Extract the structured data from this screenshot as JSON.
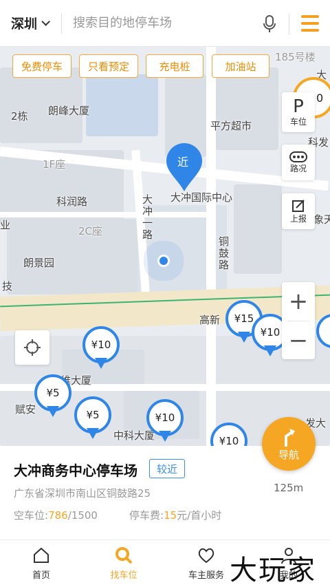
{
  "topbar": {
    "city": "深圳",
    "search_placeholder": "搜索目的地停车场"
  },
  "filters": [
    "免费停车",
    "只看预定",
    "充电桩",
    "加油站"
  ],
  "map_labels": {
    "langfeng": "朗峰大厦",
    "two_dong": "2栋",
    "one_f": "1F座",
    "kerun_road": "科润路",
    "two_c": "2C座",
    "langjing": "朗景园",
    "ye": "业",
    "dachong_road": "大冲一路",
    "tonggu_road": "铜鼓路",
    "pingfang": "平方超市",
    "center": "大冲国际中心",
    "gaoxin": "高新",
    "zhongke": "中科大厦",
    "fuan": "赋安",
    "wei": "维大厦",
    "fa": "发大",
    "ke": "科发",
    "xiangtian": "象天",
    "building185": "185号楼",
    "da": "大",
    "ji": "技",
    "lu": "路"
  },
  "near_pin": "近",
  "tools": {
    "parking_letter": "P",
    "parking_label": "车位",
    "traffic_label": "路况",
    "report_label": "上报"
  },
  "zoom": {
    "in": "+",
    "out": "−"
  },
  "pins": [
    {
      "label": "¥15"
    },
    {
      "label": "¥10"
    },
    {
      "label": "¥10"
    },
    {
      "label": "¥5"
    },
    {
      "label": "¥5"
    },
    {
      "label": "¥10"
    },
    {
      "label": "¥10"
    }
  ],
  "corner_badge": "0",
  "nav_button": "导航",
  "card": {
    "name": "大冲商务中心停车场",
    "badge": "较近",
    "distance": "125m",
    "address": "广东省深圳市南山区铜鼓路25",
    "spaces_label": "空车位:",
    "spaces_free": "786",
    "spaces_total": "/1500",
    "fee_label": "停车费:",
    "fee_value": "15",
    "fee_unit": "元/首小时"
  },
  "tabs": [
    {
      "label": "首页",
      "icon": "home-icon"
    },
    {
      "label": "找车位",
      "icon": "search-icon"
    },
    {
      "label": "车主服务",
      "icon": "heart-icon"
    },
    {
      "label": "我的",
      "icon": "person-icon"
    }
  ],
  "watermark": "大玩家",
  "colors": {
    "accent": "#f5a623",
    "pin_blue": "#2f86e6",
    "chip_border": "#f2a93b"
  }
}
